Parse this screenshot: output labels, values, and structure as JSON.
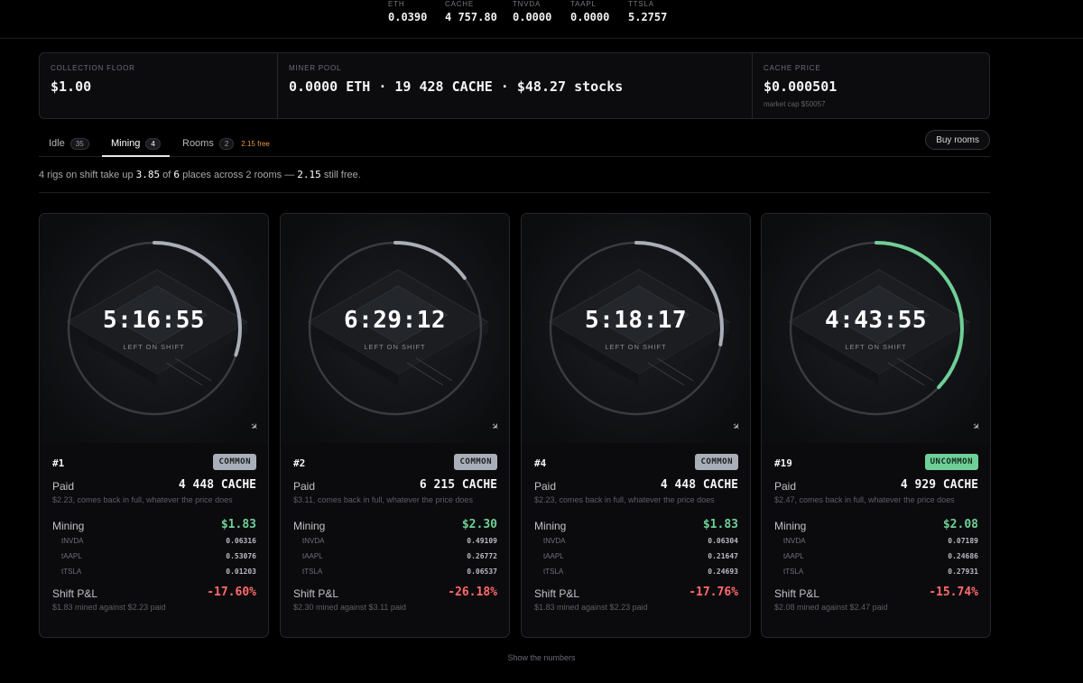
{
  "ticker": [
    {
      "label": "ETH",
      "value": "0.0390"
    },
    {
      "label": "CACHE",
      "value": "4 757.80"
    },
    {
      "label": "TNVDA",
      "value": "0.0000"
    },
    {
      "label": "TAAPL",
      "value": "0.0000"
    },
    {
      "label": "TTSLA",
      "value": "5.2757"
    }
  ],
  "stats": {
    "floor": {
      "label": "COLLECTION FLOOR",
      "value": "$1.00"
    },
    "pool": {
      "label": "MINER POOL",
      "value": "0.0000 ETH · 19 428 CACHE · $48.27 stocks"
    },
    "price": {
      "label": "CACHE PRICE",
      "value": "$0.000501",
      "sub": "market cap $50057"
    }
  },
  "tabs": {
    "idle": {
      "label": "Idle",
      "count": "35"
    },
    "mining": {
      "label": "Mining",
      "count": "4"
    },
    "rooms": {
      "label": "Rooms",
      "count": "2",
      "note": "2.15 free"
    },
    "buy_label": "Buy rooms"
  },
  "summary": {
    "p1": "4 rigs on shift take up ",
    "used": "3.85",
    "p2": " of ",
    "total": "6",
    "p3": " places across 2 rooms — ",
    "free": "2.15",
    "p4": " still free."
  },
  "card_labels": {
    "left_on_shift": "LEFT ON SHIFT",
    "paid": "Paid",
    "mining": "Mining",
    "pnl": "Shift P&L",
    "alloc_names": [
      "tNVDA",
      "tAAPL",
      "tTSLA"
    ]
  },
  "cards": [
    {
      "timer": "5:16:55",
      "progress": 0.3,
      "ring_color": "#a9afb8",
      "id": "#1",
      "rarity": "COMMON",
      "paid": "4 448 CACHE",
      "paid_note": "$2.23, comes back in full, whatever the price does",
      "mining": "$1.83",
      "alloc": [
        "0.06316",
        "0.53076",
        "0.01203"
      ],
      "pnl": "-17.60%",
      "pnl_note": "$1.83 mined against $2.23 paid"
    },
    {
      "timer": "6:29:12",
      "progress": 0.15,
      "ring_color": "#a9afb8",
      "id": "#2",
      "rarity": "COMMON",
      "paid": "6 215 CACHE",
      "paid_note": "$3.11, comes back in full, whatever the price does",
      "mining": "$2.30",
      "alloc": [
        "0.49109",
        "0.26772",
        "0.06537"
      ],
      "pnl": "-26.18%",
      "pnl_note": "$2.30 mined against $3.11 paid"
    },
    {
      "timer": "5:18:17",
      "progress": 0.28,
      "ring_color": "#a9afb8",
      "id": "#4",
      "rarity": "COMMON",
      "paid": "4 448 CACHE",
      "paid_note": "$2.23, comes back in full, whatever the price does",
      "mining": "$1.83",
      "alloc": [
        "0.06304",
        "0.21647",
        "0.24693"
      ],
      "pnl": "-17.76%",
      "pnl_note": "$1.83 mined against $2.23 paid"
    },
    {
      "timer": "4:43:55",
      "progress": 0.37,
      "ring_color": "#6fcf97",
      "id": "#19",
      "rarity": "UNCOMMON",
      "paid": "4 929 CACHE",
      "paid_note": "$2.47, comes back in full, whatever the price does",
      "mining": "$2.08",
      "alloc": [
        "0.07189",
        "0.24686",
        "0.27931"
      ],
      "pnl": "-15.74%",
      "pnl_note": "$2.08 mined against $2.47 paid"
    }
  ],
  "footer": {
    "link": "Show the numbers"
  }
}
